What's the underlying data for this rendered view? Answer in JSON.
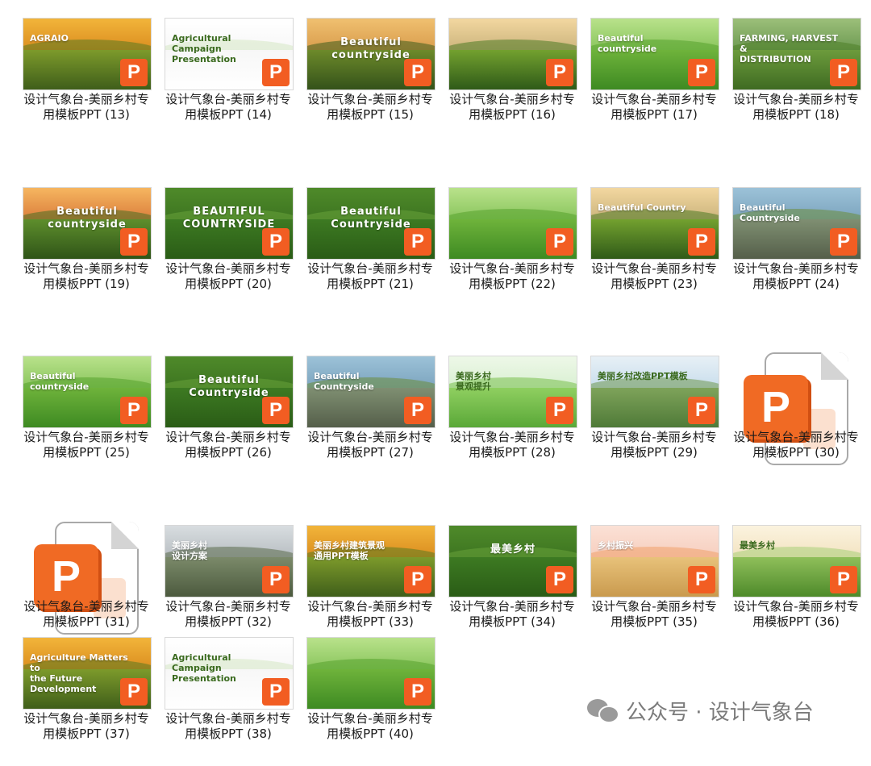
{
  "watermark": {
    "icon": "wechat-icon",
    "text": "公众号 · 设计气象台"
  },
  "badge_letter": "P",
  "tiles": [
    {
      "label": "设计气象台-美丽乡村专用模板PPT (13)",
      "thumb_text": "AGRAIO",
      "style": "a",
      "type": "thumb"
    },
    {
      "label": "设计气象台-美丽乡村专用模板PPT (14)",
      "thumb_text": "Agricultural\nCampaign\nPresentation",
      "style": "w",
      "type": "thumb"
    },
    {
      "label": "设计气象台-美丽乡村专用模板PPT (15)",
      "thumb_text": "Beautiful\ncountryside",
      "style": "b",
      "type": "thumb"
    },
    {
      "label": "设计气象台-美丽乡村专用模板PPT (16)",
      "thumb_text": "",
      "style": "c",
      "type": "thumb"
    },
    {
      "label": "设计气象台-美丽乡村专用模板PPT (17)",
      "thumb_text": "Beautiful countryside",
      "style": "g",
      "type": "thumb"
    },
    {
      "label": "设计气象台-美丽乡村专用模板PPT (18)",
      "thumb_text": "FARMING, HARVEST &\nDISTRIBUTION",
      "style": "d",
      "type": "thumb"
    },
    {
      "label": "设计气象台-美丽乡村专用模板PPT (19)",
      "thumb_text": "Beautiful\ncountryside",
      "style": "e",
      "type": "thumb"
    },
    {
      "label": "设计气象台-美丽乡村专用模板PPT (20)",
      "thumb_text": "BEAUTIFUL\nCOUNTRYSIDE",
      "style": "f",
      "type": "thumb"
    },
    {
      "label": "设计气象台-美丽乡村专用模板PPT (21)",
      "thumb_text": "Beautiful\nCountryside",
      "style": "f",
      "type": "thumb"
    },
    {
      "label": "设计气象台-美丽乡村专用模板PPT (22)",
      "thumb_text": "",
      "style": "g",
      "type": "thumb"
    },
    {
      "label": "设计气象台-美丽乡村专用模板PPT (23)",
      "thumb_text": "Beautiful Country",
      "style": "c",
      "type": "thumb"
    },
    {
      "label": "设计气象台-美丽乡村专用模板PPT (24)",
      "thumb_text": "Beautiful\nCountryside",
      "style": "h",
      "type": "thumb"
    },
    {
      "label": "设计气象台-美丽乡村专用模板PPT (25)",
      "thumb_text": "Beautiful\ncountryside",
      "style": "g",
      "type": "thumb"
    },
    {
      "label": "设计气象台-美丽乡村专用模板PPT (26)",
      "thumb_text": "Beautiful\nCountryside",
      "style": "f",
      "type": "thumb"
    },
    {
      "label": "设计气象台-美丽乡村专用模板PPT (27)",
      "thumb_text": "Beautiful\nCountryside",
      "style": "h",
      "type": "thumb"
    },
    {
      "label": "设计气象台-美丽乡村专用模板PPT (28)",
      "thumb_text": "美丽乡村\n景观提升",
      "style": "w2",
      "type": "thumb"
    },
    {
      "label": "设计气象台-美丽乡村专用模板PPT (29)",
      "thumb_text": "美丽乡村改造PPT模板",
      "style": "i",
      "type": "thumb"
    },
    {
      "label": "设计气象台-美丽乡村专用模板PPT (30)",
      "thumb_text": "",
      "style": "",
      "type": "file"
    },
    {
      "label": "设计气象台-美丽乡村专用模板PPT (31)",
      "thumb_text": "",
      "style": "",
      "type": "file"
    },
    {
      "label": "设计气象台-美丽乡村专用模板PPT (32)",
      "thumb_text": "美丽乡村\n设计方案",
      "style": "j",
      "type": "thumb"
    },
    {
      "label": "设计气象台-美丽乡村专用模板PPT (33)",
      "thumb_text": "美丽乡村建筑景观\n通用PPT模板",
      "style": "a",
      "type": "thumb"
    },
    {
      "label": "设计气象台-美丽乡村专用模板PPT (34)",
      "thumb_text": "最美乡村",
      "style": "f",
      "type": "thumb"
    },
    {
      "label": "设计气象台-美丽乡村专用模板PPT (35)",
      "thumb_text": "乡村振兴",
      "style": "k",
      "type": "thumb"
    },
    {
      "label": "设计气象台-美丽乡村专用模板PPT (36)",
      "thumb_text": "最美乡村",
      "style": "l",
      "type": "thumb"
    },
    {
      "label": "设计气象台-美丽乡村专用模板PPT (37)",
      "thumb_text": "Agriculture Matters to\nthe Future Development",
      "style": "a",
      "type": "thumb"
    },
    {
      "label": "设计气象台-美丽乡村专用模板PPT (38)",
      "thumb_text": "Agricultural\nCampaign\nPresentation",
      "style": "w",
      "type": "thumb"
    },
    {
      "label": "设计气象台-美丽乡村专用模板PPT (40)",
      "thumb_text": "",
      "style": "g",
      "type": "thumb"
    }
  ]
}
